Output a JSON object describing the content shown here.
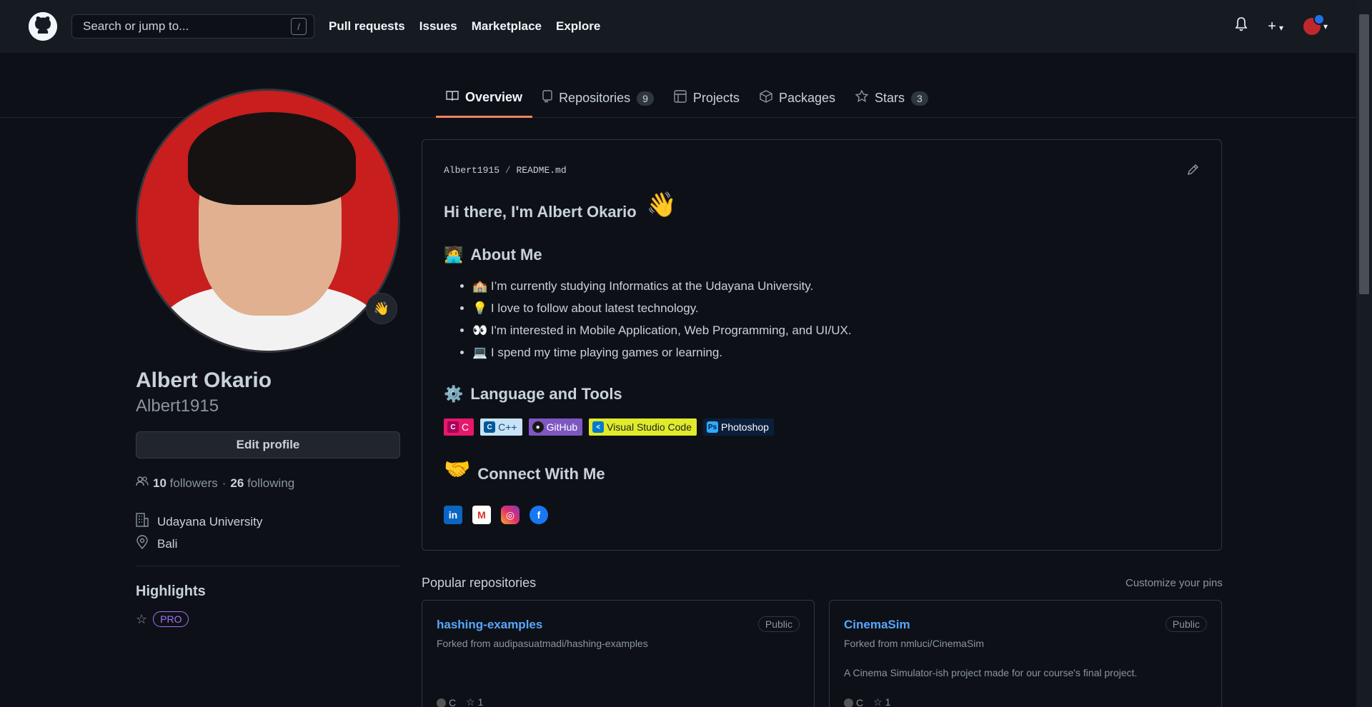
{
  "header": {
    "search_placeholder": "Search or jump to...",
    "search_shortcut": "/",
    "nav": [
      "Pull requests",
      "Issues",
      "Marketplace",
      "Explore"
    ]
  },
  "tabs": [
    {
      "label": "Overview",
      "count": "",
      "icon": "book-icon"
    },
    {
      "label": "Repositories",
      "count": "9",
      "icon": "repo-icon"
    },
    {
      "label": "Projects",
      "count": "",
      "icon": "table-icon"
    },
    {
      "label": "Packages",
      "count": "",
      "icon": "package-icon"
    },
    {
      "label": "Stars",
      "count": "3",
      "icon": "star-icon"
    }
  ],
  "profile": {
    "name": "Albert Okario",
    "username": "Albert1915",
    "edit_label": "Edit profile",
    "followers": "10",
    "followers_label": "followers",
    "following": "26",
    "following_label": "following",
    "dot": "·",
    "org": "Udayana University",
    "location": "Bali",
    "highlights_title": "Highlights",
    "pro": "PRO",
    "status_emoji": "👋"
  },
  "readme": {
    "owner": "Albert1915",
    "sep": "/",
    "file": "README.md",
    "greeting": "Hi there, I'm Albert Okario",
    "greeting_emoji": "👋",
    "about_title": "About Me",
    "about_emoji": "🧑‍💻",
    "bullets": [
      {
        "emoji": "🏫",
        "text": "I’m currently studying Informatics at the Udayana University."
      },
      {
        "emoji": "💡",
        "text": "I love to follow about latest technology."
      },
      {
        "emoji": "👀",
        "text": "I'm interested in Mobile Application, Web Programming, and UI/UX."
      },
      {
        "emoji": "💻",
        "text": "I spend my time playing games or learning."
      }
    ],
    "tools_title": "Language and Tools",
    "tools_emoji": "⚙️",
    "badges": [
      "C",
      "C++",
      "GitHub",
      "Visual Studio Code",
      "Photoshop"
    ],
    "connect_title": "Connect With Me",
    "connect_emoji": "🤝",
    "socials": [
      "in",
      "M",
      "◎",
      "f"
    ]
  },
  "popular": {
    "title": "Popular repositories",
    "customize": "Customize your pins",
    "repos": [
      {
        "name": "hashing-examples",
        "visibility": "Public",
        "fork": "Forked from audipasuatmadi/hashing-examples",
        "desc": "",
        "lang": "C",
        "stars": "1"
      },
      {
        "name": "CinemaSim",
        "visibility": "Public",
        "fork": "Forked from nmluci/CinemaSim",
        "desc": "A Cinema Simulator-ish project made for our course's final project.",
        "lang": "C",
        "stars": "1"
      }
    ]
  },
  "colors": {
    "accent": "#f78166",
    "link": "#58a6ff",
    "bg": "#0d1117",
    "header": "#161b22"
  }
}
